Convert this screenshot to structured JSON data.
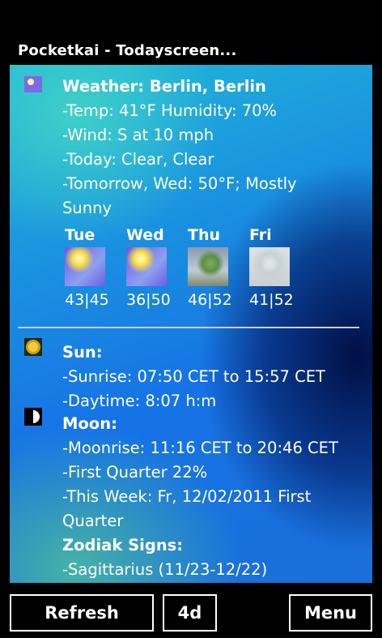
{
  "app_title": "Pocketkai - Todayscreen...",
  "weather": {
    "header": "Weather: Berlin, Berlin",
    "lines": [
      "-Temp: 41°F Humidity: 70%",
      "-Wind: S at 10 mph",
      "-Today: Clear, Clear",
      "-Tomorrow, Wed: 50°F; Mostly",
      "Sunny"
    ],
    "forecast": [
      {
        "day": "Tue",
        "temps": "43|45",
        "icon": "sunny-icon"
      },
      {
        "day": "Wed",
        "temps": "36|50",
        "icon": "sunny-icon"
      },
      {
        "day": "Thu",
        "temps": "46|52",
        "icon": "cloudy-tree-icon"
      },
      {
        "day": "Fri",
        "temps": "41|52",
        "icon": "fog-icon"
      }
    ]
  },
  "sun": {
    "header": "Sun:",
    "lines": [
      "-Sunrise: 07:50 CET to 15:57 CET",
      "-Daytime: 8:07 h:m"
    ]
  },
  "moon": {
    "header": "Moon:",
    "lines": [
      "-Moonrise: 11:16 CET to 20:46 CET",
      "-First Quarter 22%",
      "-This Week: Fr, 12/02/2011 First",
      "Quarter"
    ]
  },
  "zodiac": {
    "header": "Zodiak Signs:",
    "lines": [
      "-Sagittarius (11/23-12/22)"
    ]
  },
  "buttons": {
    "refresh": "Refresh",
    "days": "4d",
    "menu": "Menu"
  }
}
